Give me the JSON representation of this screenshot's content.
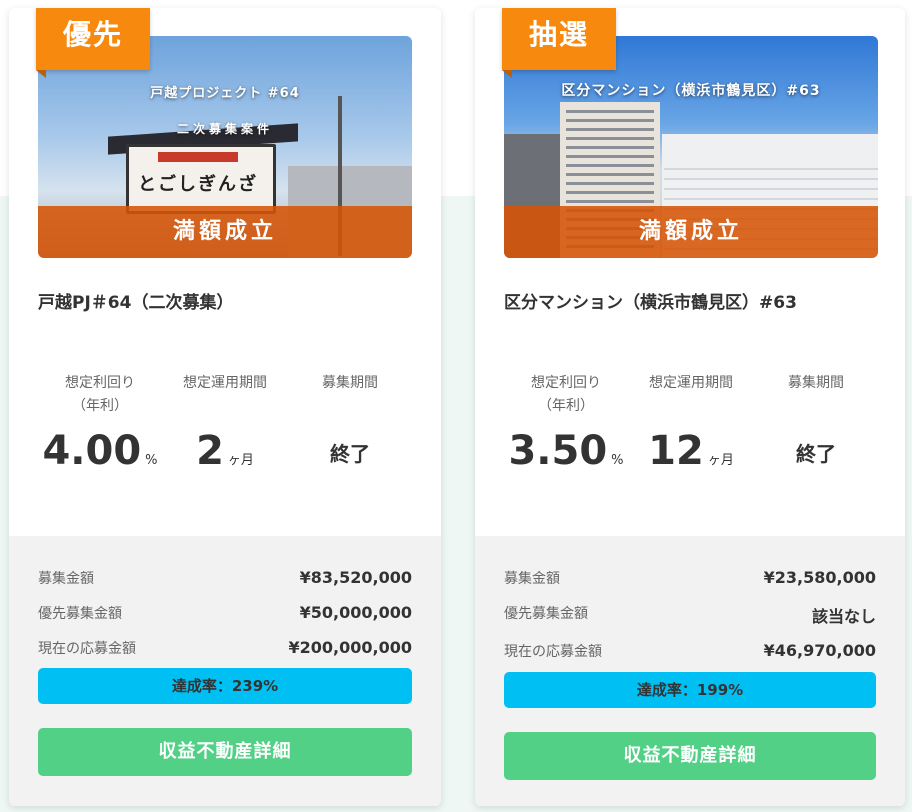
{
  "cards": [
    {
      "badge": "優先",
      "image_title": "戸越プロジェクト #64",
      "image_subtitle": "二次募集案件",
      "image_sign": "とごしぎんざ",
      "status": "満額成立",
      "title": "戸越PJ＃64（二次募集）",
      "metrics": {
        "yield_label_line1": "想定利回り",
        "yield_label_line2": "（年利）",
        "yield_value": "4.00",
        "yield_unit": "%",
        "period_label": "想定運用期間",
        "period_value": "2",
        "period_unit": "ヶ月",
        "recruit_label": "募集期間",
        "recruit_value": "終了"
      },
      "rows": [
        {
          "label": "募集金額",
          "value": "¥83,520,000"
        },
        {
          "label": "優先募集金額",
          "value": "¥50,000,000"
        },
        {
          "label": "現在の応募金額",
          "value": "¥200,000,000"
        }
      ],
      "progress_label": "達成率：239%",
      "progress_percent": 239,
      "detail_button": "収益不動産詳細"
    },
    {
      "badge": "抽選",
      "image_title": "区分マンション（横浜市鶴見区）#63",
      "status": "満額成立",
      "title": "区分マンション（横浜市鶴見区）#63",
      "metrics": {
        "yield_label_line1": "想定利回り",
        "yield_label_line2": "（年利）",
        "yield_value": "3.50",
        "yield_unit": "%",
        "period_label": "想定運用期間",
        "period_value": "12",
        "period_unit": "ヶ月",
        "recruit_label": "募集期間",
        "recruit_value": "終了"
      },
      "rows": [
        {
          "label": "募集金額",
          "value": "¥23,580,000"
        },
        {
          "label": "優先募集金額",
          "value": "該当なし"
        },
        {
          "label": "現在の応募金額",
          "value": "¥46,970,000"
        }
      ],
      "progress_label": "達成率：199%",
      "progress_percent": 199,
      "detail_button": "収益不動産詳細"
    }
  ],
  "colors": {
    "badge": "#f7890f",
    "status_band": "#d65406",
    "progress": "#00c0f3",
    "detail_button": "#51d086"
  }
}
